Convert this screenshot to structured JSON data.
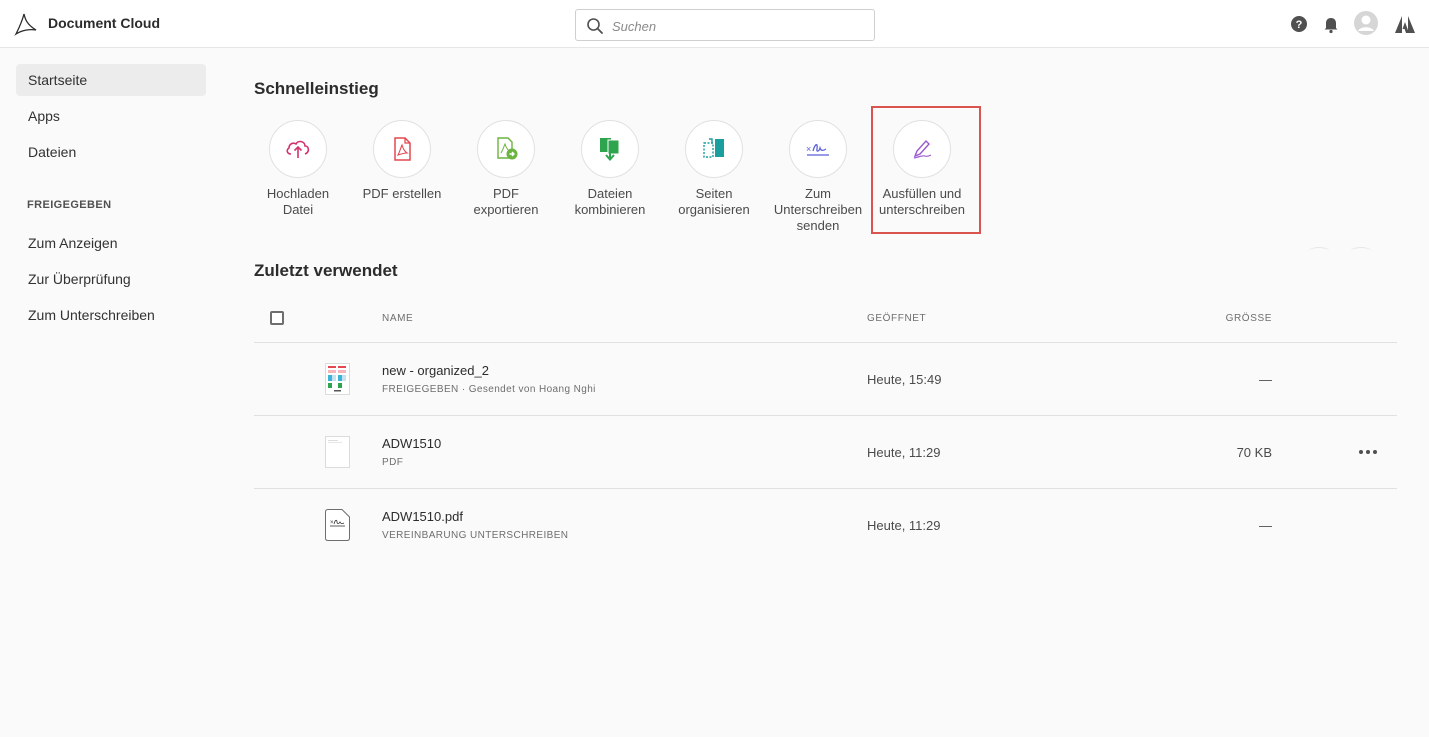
{
  "header": {
    "app_title": "Document Cloud",
    "search_placeholder": "Suchen"
  },
  "sidebar": {
    "items": [
      {
        "label": "Startseite",
        "active": true
      },
      {
        "label": "Apps"
      },
      {
        "label": "Dateien"
      }
    ],
    "section_label": "FREIGEGEBEN",
    "shared_items": [
      {
        "label": "Zum Anzeigen"
      },
      {
        "label": "Zur Überprüfung"
      },
      {
        "label": "Zum Unterschreiben"
      }
    ]
  },
  "quick_access": {
    "title": "Schnelleinstieg",
    "tools": [
      {
        "line1": "Hochladen",
        "line2": "Datei",
        "line3": "",
        "icon": "upload-cloud-icon",
        "color": "#d4326e"
      },
      {
        "line1": "PDF erstellen",
        "line2": "",
        "line3": "",
        "icon": "create-pdf-icon",
        "color": "#e34850"
      },
      {
        "line1": "PDF",
        "line2": "exportieren",
        "line3": "",
        "icon": "export-pdf-icon",
        "color": "#6cb33f"
      },
      {
        "line1": "Dateien",
        "line2": "kombinieren",
        "line3": "",
        "icon": "combine-files-icon",
        "color": "#2ea44f"
      },
      {
        "line1": "Seiten",
        "line2": "organisieren",
        "line3": "",
        "icon": "organize-pages-icon",
        "color": "#1a9e9e"
      },
      {
        "line1": "Zum",
        "line2": "Unterschreiben",
        "line3": "senden",
        "icon": "send-for-signature-icon",
        "color": "#5b62d6"
      },
      {
        "line1": "Ausfüllen und",
        "line2": "unterschreiben",
        "line3": "",
        "icon": "fill-sign-icon",
        "color": "#9b59d0"
      }
    ]
  },
  "recent": {
    "title": "Zuletzt verwendet",
    "columns": {
      "name": "NAME",
      "opened": "GEÖFFNET",
      "size": "GRÖSSE"
    },
    "rows": [
      {
        "name": "new - organized_2",
        "sub": "FREIGEGEBEN · Gesendet von Hoang Nghi",
        "opened": "Heute, 15:49",
        "size": "—"
      },
      {
        "name": "ADW1510",
        "sub": "PDF",
        "opened": "Heute, 11:29",
        "size": "70 KB"
      },
      {
        "name": "ADW1510.pdf",
        "sub": "VEREINBARUNG UNTERSCHREIBEN",
        "opened": "Heute, 11:29",
        "size": "—"
      }
    ]
  },
  "colors": {
    "accent_highlight": "#d9534f"
  }
}
